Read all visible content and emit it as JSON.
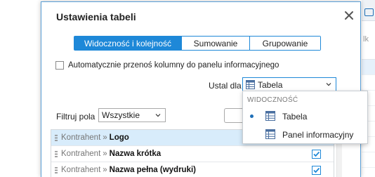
{
  "background": {
    "column_header": "lk"
  },
  "dialog": {
    "title": "Ustawienia tabeli",
    "tabs": [
      {
        "label": "Widoczność i kolejność",
        "active": true
      },
      {
        "label": "Sumowanie",
        "active": false
      },
      {
        "label": "Grupowanie",
        "active": false
      }
    ],
    "auto_move_checkbox": {
      "label": "Automatycznie przenoś kolumny do panelu informacyjnego",
      "checked": false
    },
    "ustal_dla": {
      "label": "Ustal dla",
      "value": "Tabela"
    },
    "filter": {
      "label": "Filtruj pola",
      "value": "Wszystkie",
      "search_value": ""
    },
    "rows": [
      {
        "parent": "Kontrahent",
        "separator": "»",
        "field": "Logo",
        "checked": false,
        "selected": true
      },
      {
        "parent": "Kontrahent",
        "separator": "»",
        "field": "Nazwa krótka",
        "checked": true,
        "selected": false
      },
      {
        "parent": "Kontrahent",
        "separator": "»",
        "field": "Nazwa pełna (wydruki)",
        "checked": true,
        "selected": false
      }
    ]
  },
  "dropdown": {
    "section_header": "WIDOCZNOŚĆ",
    "items": [
      {
        "label": "Tabela",
        "selected": true,
        "icon": "table-icon"
      },
      {
        "label": "Panel informacyjny",
        "selected": false,
        "icon": "table-icon"
      }
    ]
  },
  "colors": {
    "accent": "#1e88d8",
    "selected_row": "#d8ecfb"
  }
}
